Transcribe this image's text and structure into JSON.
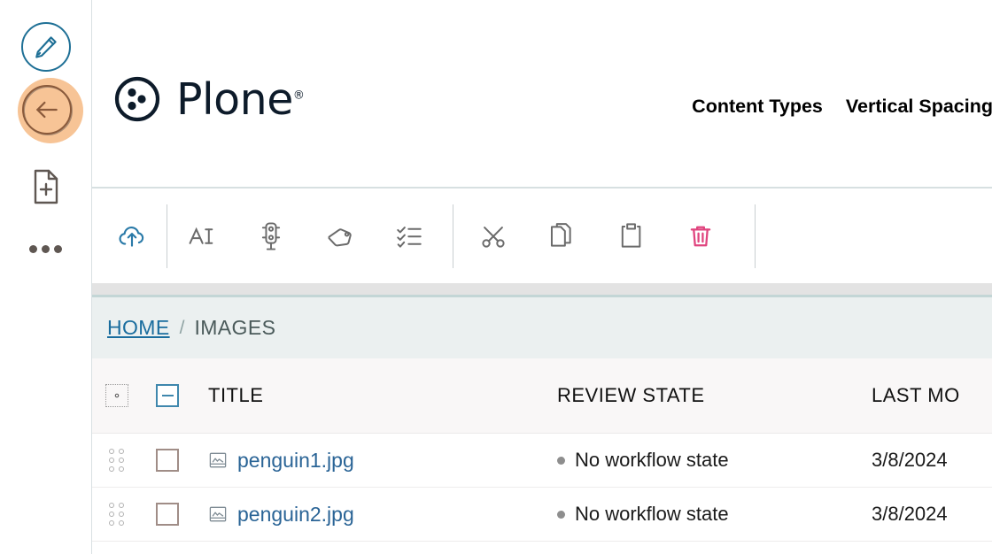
{
  "sidebar": {
    "items": [
      {
        "name": "edit-button",
        "icon": "pencil-icon",
        "label": "Edit"
      },
      {
        "name": "back-button",
        "icon": "arrow-left-icon",
        "label": "Back"
      },
      {
        "name": "add-content-button",
        "icon": "document-plus-icon",
        "label": "Add new"
      },
      {
        "name": "more-button",
        "icon": "more-horizontal-icon",
        "label": "More"
      }
    ]
  },
  "header": {
    "logo_text": "Plone",
    "logo_registered": "®",
    "logo_icon": "plone-logo-icon",
    "nav": [
      {
        "label": "Content Types"
      },
      {
        "label": "Vertical Spacing"
      }
    ]
  },
  "toolbar": {
    "groups": [
      {
        "items": [
          {
            "name": "upload-button",
            "icon": "cloud-upload-icon",
            "label": "Upload",
            "color": "#2a7aa8"
          }
        ]
      },
      {
        "items": [
          {
            "name": "rename-button",
            "icon": "text-rename-icon",
            "label": "Rename",
            "color": "#6b6b6b"
          },
          {
            "name": "workflow-state-button",
            "icon": "traffic-light-icon",
            "label": "State",
            "color": "#6b6b6b"
          },
          {
            "name": "tags-button",
            "icon": "tag-icon",
            "label": "Tags",
            "color": "#6b6b6b"
          },
          {
            "name": "properties-button",
            "icon": "checklist-icon",
            "label": "Properties",
            "color": "#6b6b6b"
          }
        ]
      },
      {
        "items": [
          {
            "name": "cut-button",
            "icon": "scissors-icon",
            "label": "Cut",
            "color": "#6b6b6b"
          },
          {
            "name": "copy-button",
            "icon": "copy-icon",
            "label": "Copy",
            "color": "#6b6b6b"
          },
          {
            "name": "paste-button",
            "icon": "clipboard-icon",
            "label": "Paste",
            "color": "#6b6b6b"
          },
          {
            "name": "delete-button",
            "icon": "trash-icon",
            "label": "Delete",
            "color": "#e0447e"
          }
        ]
      }
    ]
  },
  "breadcrumb": {
    "home": "HOME",
    "separator": "/",
    "current": "IMAGES"
  },
  "table": {
    "columns": {
      "settings_icon": "gear-icon",
      "select_all": "indeterminate-checkbox",
      "title": "TITLE",
      "review_state": "REVIEW STATE",
      "last_modified": "LAST MO"
    },
    "rows": [
      {
        "handle": "drag-handle-icon",
        "selected": false,
        "icon": "image-file-icon",
        "title": "penguin1.jpg",
        "review_state": "No workflow state",
        "state_color": "#8e8e8e",
        "last_modified": "3/8/2024"
      },
      {
        "handle": "drag-handle-icon",
        "selected": false,
        "icon": "image-file-icon",
        "title": "penguin2.jpg",
        "review_state": "No workflow state",
        "state_color": "#8e8e8e",
        "last_modified": "3/8/2024"
      }
    ]
  },
  "colors": {
    "link": "#2a6496",
    "breadcrumb_bg": "#ebf0f0",
    "table_header_bg": "#f9f7f7",
    "delete_accent": "#e0447e",
    "edit_accent": "#1f7096",
    "back_halo": "#f7c496"
  }
}
